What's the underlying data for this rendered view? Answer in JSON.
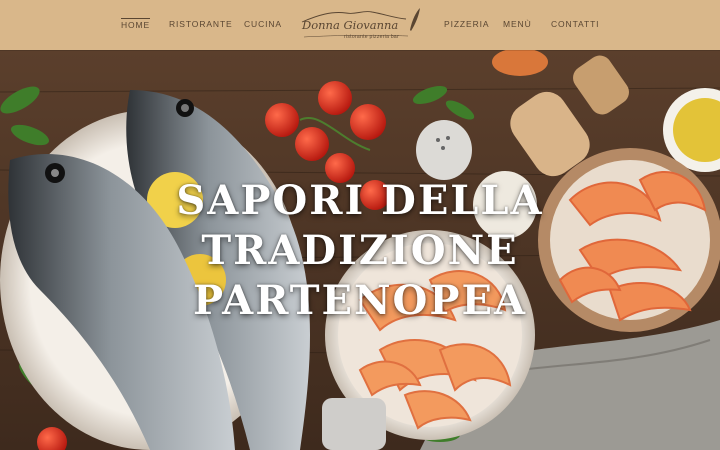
{
  "nav": {
    "left_items": [
      {
        "label": "HOME",
        "active": true
      },
      {
        "label": "RISTORANTE",
        "active": false
      },
      {
        "label": "CUCINA",
        "active": false
      }
    ],
    "right_items": [
      {
        "label": "PIZZERIA",
        "active": false
      },
      {
        "label": "MENÙ",
        "active": false
      },
      {
        "label": "CONTATTI",
        "active": false
      }
    ],
    "bar_color": "#d9b78a",
    "text_color": "#5a4632"
  },
  "logo": {
    "name": "Donna Giovanna",
    "tagline": "ristorante pizzeria bar",
    "icon": "vesuvius-quill-logo"
  },
  "hero": {
    "headline_lines": [
      "SAPORI DELLA",
      "TRADIZIONE",
      "PARTENOPEA"
    ],
    "image": "fish-shrimp-tomatoes-on-wooden-table"
  }
}
